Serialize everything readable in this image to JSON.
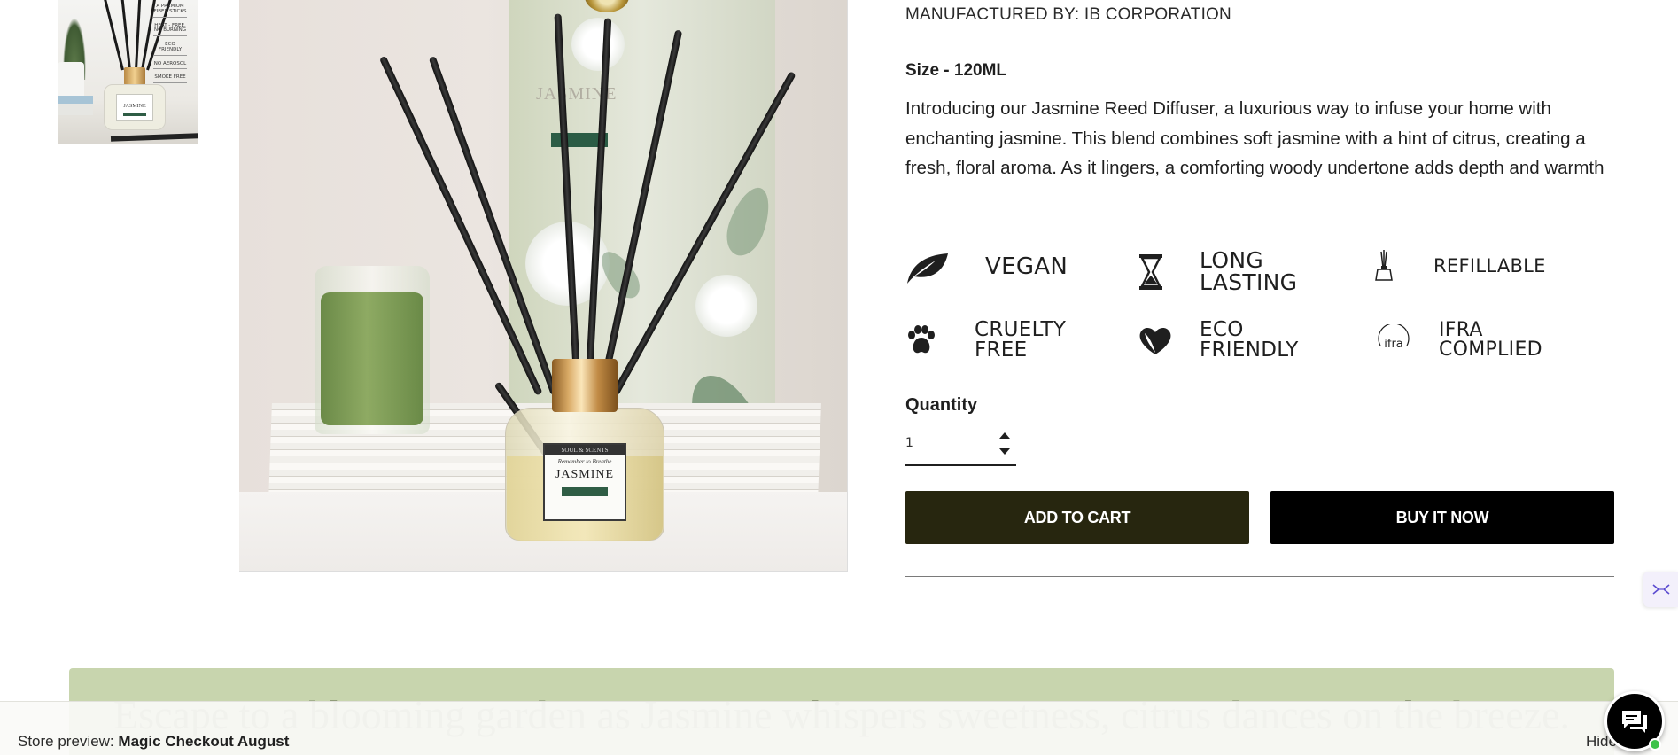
{
  "product": {
    "manufacturer": "MANUFACTURED BY: IB CORPORATION",
    "size": "Size - 120ML",
    "description": "Introducing our Jasmine Reed Diffuser, a luxurious way to infuse your home with enchanting jasmine. This blend combines soft jasmine with a hint of citrus, creating a fresh, floral aroma. As it lingers, a comforting woody undertone adds depth and warmth"
  },
  "thumbnail": {
    "notes": [
      "A PREMIUM FIBER STICKS",
      "HEAT - FREE, NO BURNING",
      "ECO FRIENDLY",
      "NO AEROSOL",
      "SMOKE FREE"
    ],
    "label_name": "JASMINE"
  },
  "image": {
    "box_text": "JASMINE",
    "label_brand": "SOUL & SCENTS",
    "label_script": "Remember to Breathe",
    "label_name": "JASMINE"
  },
  "features": [
    {
      "icon": "leaf-icon",
      "label": "VEGAN"
    },
    {
      "icon": "hourglass-icon",
      "label": "LONG\nLASTING"
    },
    {
      "icon": "diffuser-icon",
      "label": "REFILLABLE"
    },
    {
      "icon": "paw-icon",
      "label": "CRUELTY\nFREE"
    },
    {
      "icon": "heart-leaf-icon",
      "label": "ECO\nFRIENDLY"
    },
    {
      "icon": "ifra-icon",
      "label": "IFRA\nCOMPLIED",
      "icon_text": "ifra"
    }
  ],
  "quantity": {
    "label": "Quantity",
    "value": "1"
  },
  "buttons": {
    "add_to_cart": "ADD TO CART",
    "buy_now": "BUY IT NOW"
  },
  "banner": {
    "text": "Escape to a blooming garden as Jasmine whispers sweetness, citrus dances on the breeze.",
    "color": "#c8d5ae"
  },
  "preview_bar": {
    "prefix": "Store preview:",
    "store_name": "Magic Checkout August",
    "hide_label": "Hide"
  },
  "colors": {
    "add_to_cart_bg": "#27260f",
    "buy_now_bg": "#000000",
    "status_online": "#3ec24a"
  }
}
